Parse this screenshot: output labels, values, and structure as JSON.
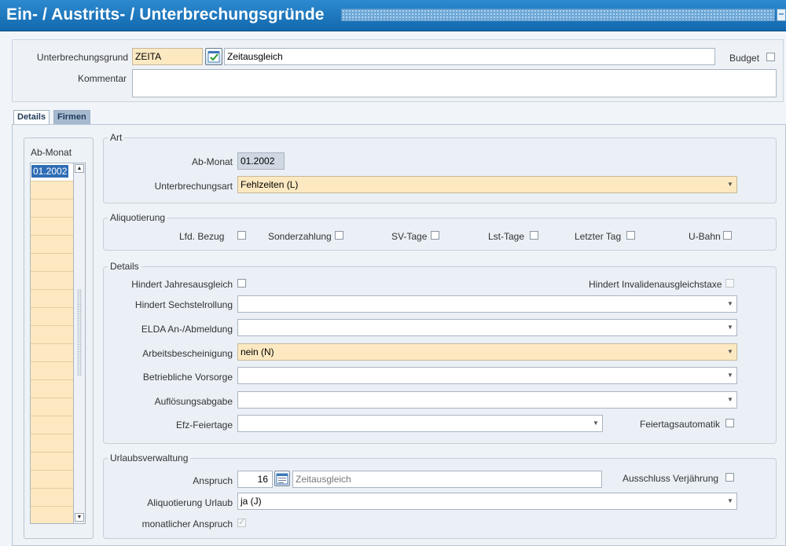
{
  "window": {
    "title": "Ein- / Austritts- / Unterbrechungsgründe",
    "minimize_symbol": "–"
  },
  "header": {
    "unterbrechungsgrund_label": "Unterbrechungsgrund",
    "code_value": "ZEITA",
    "description_value": "Zeitausgleich",
    "budget_label": "Budget",
    "kommentar_label": "Kommentar",
    "kommentar_value": ""
  },
  "tabs": [
    {
      "label": "Details",
      "active": true
    },
    {
      "label": "Firmen",
      "active": false
    }
  ],
  "month_list": {
    "header": "Ab-Monat",
    "items": [
      "01.2002",
      "",
      "",
      "",
      "",
      "",
      "",
      "",
      "",
      "",
      "",
      "",
      "",
      "",
      "",
      "",
      "",
      "",
      ""
    ]
  },
  "art": {
    "legend": "Art",
    "ab_monat_label": "Ab-Monat",
    "ab_monat_value": "01.2002",
    "unterbrechungsart_label": "Unterbrechungsart",
    "unterbrechungsart_value": "Fehlzeiten (L)"
  },
  "aliquotierung": {
    "legend": "Aliquotierung",
    "items": [
      "Lfd. Bezug",
      "Sonderzahlung",
      "SV-Tage",
      "Lst-Tage",
      "Letzter Tag",
      "U-Bahn"
    ]
  },
  "details": {
    "legend": "Details",
    "hindert_jahresausgleich_label": "Hindert Jahresausgleich",
    "hindert_invalidenausgleichstaxe_label": "Hindert Invalidenausgleichstaxe",
    "sechstelrollung_label": "Hindert Sechstelrollung",
    "sechstelrollung_value": "",
    "elda_label": "ELDA An-/Abmeldung",
    "elda_value": "",
    "arbeitsbescheinigung_label": "Arbeitsbescheinigung",
    "arbeitsbescheinigung_value": "nein (N)",
    "vorsorge_label": "Betriebliche Vorsorge",
    "vorsorge_value": "",
    "aufloesung_label": "Auflösungsabgabe",
    "aufloesung_value": "",
    "efz_label": "Efz-Feiertage",
    "efz_value": "",
    "feiertagsautomatik_label": "Feiertagsautomatik"
  },
  "urlaub": {
    "legend": "Urlaubsverwaltung",
    "anspruch_label": "Anspruch",
    "anspruch_value": "16",
    "anspruch_desc": "Zeitausgleich",
    "ausschluss_label": "Ausschluss Verjährung",
    "aliquotierung_label": "Aliquotierung Urlaub",
    "aliquotierung_value": "ja (J)",
    "monatlich_label": "monatlicher Anspruch"
  },
  "colors": {
    "title_bar": "#1a75bf",
    "required_field": "#fde9c1",
    "selection": "#2f6db5"
  }
}
